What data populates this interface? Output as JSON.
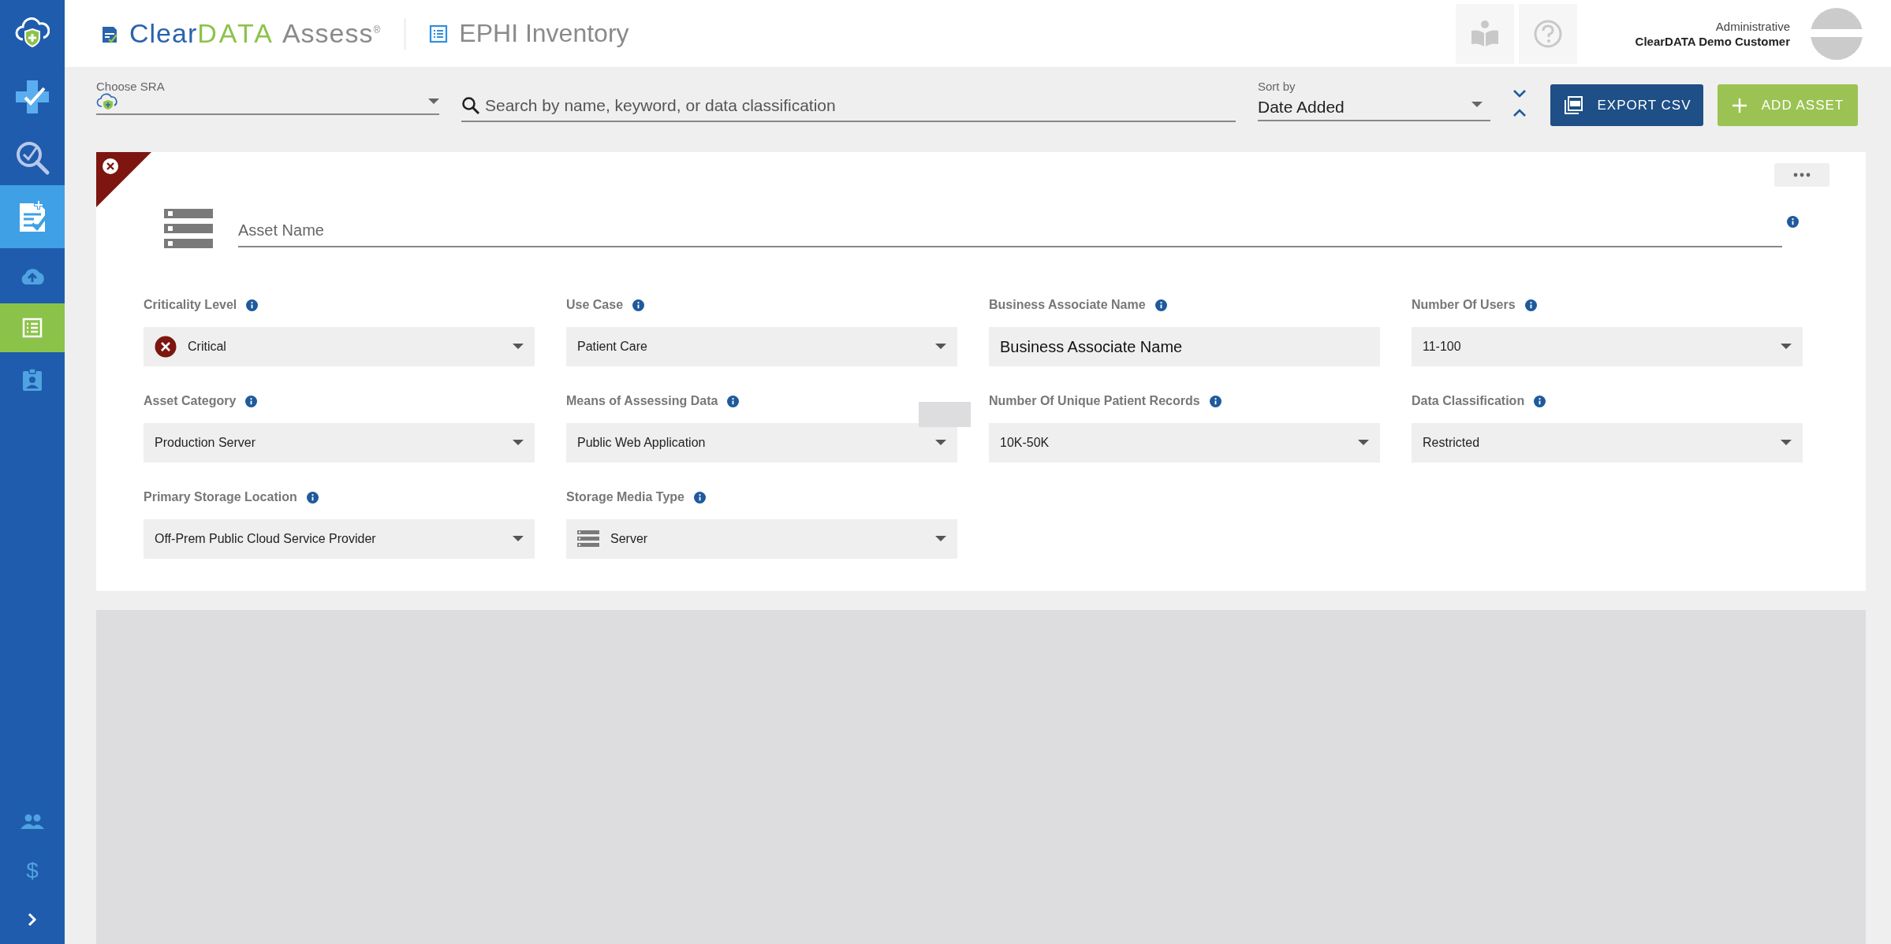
{
  "sidebar": {
    "items": [
      {
        "kind": "cloud-shield",
        "selected": false,
        "highlighted": false
      },
      {
        "kind": "cross-check",
        "selected": false,
        "highlighted": false
      },
      {
        "kind": "search-check",
        "selected": false,
        "highlighted": false
      },
      {
        "kind": "document-plus",
        "selected": false,
        "highlighted": true
      },
      {
        "kind": "cloud-upload",
        "selected": false,
        "highlighted": false
      },
      {
        "kind": "list",
        "selected": true,
        "highlighted": false
      },
      {
        "kind": "badge",
        "selected": false,
        "highlighted": false
      }
    ],
    "bottom_items": [
      {
        "kind": "people"
      },
      {
        "kind": "glyph",
        "glyph": "$"
      },
      {
        "kind": "chevron"
      }
    ]
  },
  "header": {
    "logo": {
      "part_1": "Clear",
      "part_2": "DATA",
      "part_3": "Assess",
      "mark": "®"
    },
    "page_title": "EPHI Inventory",
    "user": {
      "role": "Administrative",
      "organization": "ClearDATA Demo Customer"
    }
  },
  "toolbar": {
    "sra": {
      "label": "Choose SRA"
    },
    "search": {
      "placeholder": "Search by name, keyword, or data classification"
    },
    "sort": {
      "label": "Sort by",
      "value": "Date Added"
    },
    "buttons": [
      {
        "kind": "export",
        "label": "EXPORT CSV"
      },
      {
        "kind": "add",
        "label": "ADD ASSET"
      }
    ]
  },
  "asset_card": {
    "name_placeholder": "Asset Name",
    "fields": [
      {
        "label": "Criticality Level",
        "kind": "select",
        "value": "Critical",
        "icon": {
          "kind": "critical"
        }
      },
      {
        "label": "Use Case",
        "kind": "select",
        "value": "Patient Care"
      },
      {
        "label": "Business Associate Name",
        "kind": "text",
        "value": "Business Associate Name"
      },
      {
        "label": "Number Of Users",
        "kind": "select",
        "value": "11-100"
      },
      {
        "label": "Asset Category",
        "kind": "select",
        "value": "Production Server"
      },
      {
        "label": "Means of Assessing Data",
        "kind": "select",
        "value": "Public Web Application"
      },
      {
        "label": "Number Of Unique Patient Records",
        "kind": "select",
        "value": "10K-50K"
      },
      {
        "label": "Data Classification",
        "kind": "select",
        "value": "Restricted"
      },
      {
        "label": "Primary Storage Location",
        "kind": "select",
        "value": "Off-Prem Public Cloud Service Provider"
      },
      {
        "label": "Storage Media Type",
        "kind": "select",
        "value": "Server",
        "icon": {
          "kind": "server"
        }
      }
    ]
  }
}
